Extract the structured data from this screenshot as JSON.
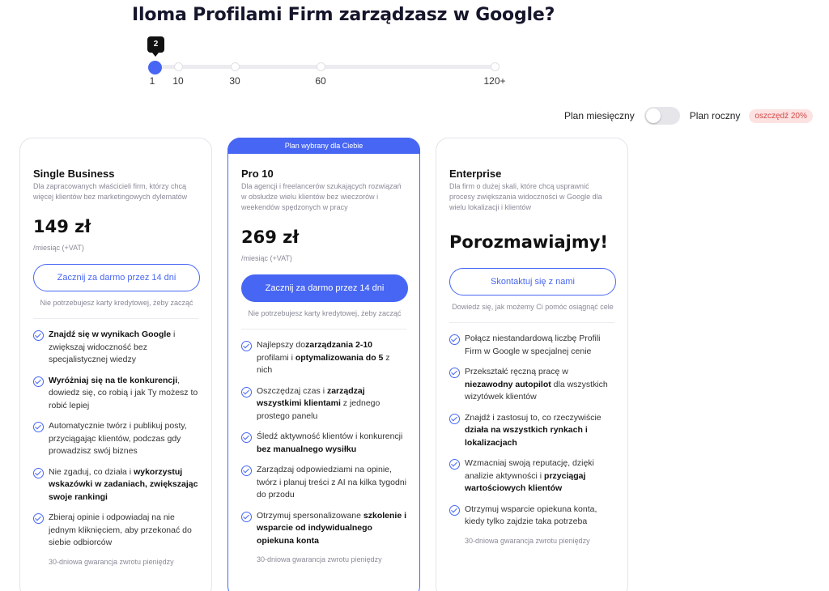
{
  "header": {
    "title": "Iloma Profilami Firm zarządzasz w Google?"
  },
  "slider": {
    "tooltip": "2",
    "value": 2,
    "labels": [
      "1",
      "10",
      "30",
      "60",
      "120+"
    ]
  },
  "billing": {
    "monthly_label": "Plan miesięczny",
    "yearly_label": "Plan roczny",
    "save_badge": "oszczędź 20%",
    "yearly_selected": false
  },
  "plans": [
    {
      "name": "Single Business",
      "description": "Dla zapracowanych właścicieli firm, którzy chcą więcej klientów bez marketingowych dylematów",
      "price": "149 zł",
      "period": "/miesiąc (+VAT)",
      "cta": "Zacznij za darmo przez 14 dni",
      "cta_note": "Nie potrzebujesz karty kredytowej, żeby zacząć",
      "features": [
        [
          {
            "b": true,
            "t": "Znajdź się w wynikach Google"
          },
          {
            "b": false,
            "t": " i zwiększaj widoczność bez specjalistycznej wiedzy"
          }
        ],
        [
          {
            "b": true,
            "t": "Wyróżniaj się na tle konkurencji"
          },
          {
            "b": false,
            "t": ", dowiedz się, co robią i jak Ty możesz to robić lepiej"
          }
        ],
        [
          {
            "b": false,
            "t": "Automatycznie twórz i publikuj posty, przyciągając klientów, podczas gdy prowadzisz swój biznes"
          }
        ],
        [
          {
            "b": false,
            "t": "Nie zgaduj, co działa i "
          },
          {
            "b": true,
            "t": "wykorzystuj wskazówki w zadaniach, zwiększając swoje rankingi"
          }
        ],
        [
          {
            "b": false,
            "t": "Zbieraj opinie i odpowiadaj na nie jednym kliknięciem, aby przekonać do siebie odbiorców"
          }
        ]
      ],
      "guarantee": "30-dniowa gwarancja zwrotu pieniędzy"
    },
    {
      "banner": "Plan wybrany dla Ciebie",
      "name": "Pro 10",
      "description": "Dla agencji i freelancerów szukających rozwiązań w obsłudze wielu klientów bez wieczorów i weekendów spędzonych w pracy",
      "price": "269 zł",
      "period": "/miesiąc (+VAT)",
      "cta": "Zacznij za darmo przez 14 dni",
      "cta_note": "Nie potrzebujesz karty kredytowej, żeby zacząć",
      "features": [
        [
          {
            "b": false,
            "t": "Najlepszy do"
          },
          {
            "b": true,
            "t": "zarządzania 2-10"
          },
          {
            "b": false,
            "t": " profilami i "
          },
          {
            "b": true,
            "t": "optymalizowania do 5"
          },
          {
            "b": false,
            "t": " z nich"
          }
        ],
        [
          {
            "b": false,
            "t": "Oszczędzaj czas i "
          },
          {
            "b": true,
            "t": "zarządzaj wszystkimi klientami"
          },
          {
            "b": false,
            "t": " z jednego prostego panelu"
          }
        ],
        [
          {
            "b": false,
            "t": "Śledź aktywność klientów i konkurencji "
          },
          {
            "b": true,
            "t": "bez manualnego wysiłku"
          }
        ],
        [
          {
            "b": false,
            "t": "Zarządzaj odpowiedziami na opinie, twórz i planuj treści z AI na kilka tygodni do przodu"
          }
        ],
        [
          {
            "b": false,
            "t": "Otrzymuj spersonalizowane "
          },
          {
            "b": true,
            "t": "szkolenie i wsparcie od indywidualnego opiekuna konta"
          }
        ]
      ],
      "guarantee": "30-dniowa gwarancja zwrotu pieniędzy"
    },
    {
      "name": "Enterprise",
      "description": "Dla firm o dużej skali, które chcą usprawnić procesy zwiększania widoczności w Google dla wielu lokalizacji i klientów",
      "price": "Porozmawiajmy!",
      "period": "",
      "cta": "Skontaktuj się z nami",
      "cta_note": "Dowiedz się, jak możemy Ci pomóc osiągnąć cele",
      "features": [
        [
          {
            "b": false,
            "t": "Połącz niestandardową liczbę Profili Firm w Google w specjalnej cenie"
          }
        ],
        [
          {
            "b": false,
            "t": "Przekształć ręczną pracę w "
          },
          {
            "b": true,
            "t": "niezawodny autopilot"
          },
          {
            "b": false,
            "t": " dla wszystkich wizytówek klientów"
          }
        ],
        [
          {
            "b": false,
            "t": "Znajdź i zastosuj to, co rzeczywiście "
          },
          {
            "b": true,
            "t": "działa na wszystkich rynkach i lokalizacjach"
          }
        ],
        [
          {
            "b": false,
            "t": "Wzmacniaj swoją reputację, dzięki analizie aktywności i "
          },
          {
            "b": true,
            "t": "przyciągaj wartościowych klientów"
          }
        ],
        [
          {
            "b": false,
            "t": "Otrzymuj wsparcie opiekuna konta, kiedy tylko zajdzie taka potrzeba"
          }
        ]
      ],
      "guarantee": "30-dniowa gwarancja zwrotu pieniędzy"
    }
  ],
  "colors": {
    "accent": "#4766f3",
    "badge_bg": "#fde2e2",
    "badge_text": "#d24848"
  }
}
